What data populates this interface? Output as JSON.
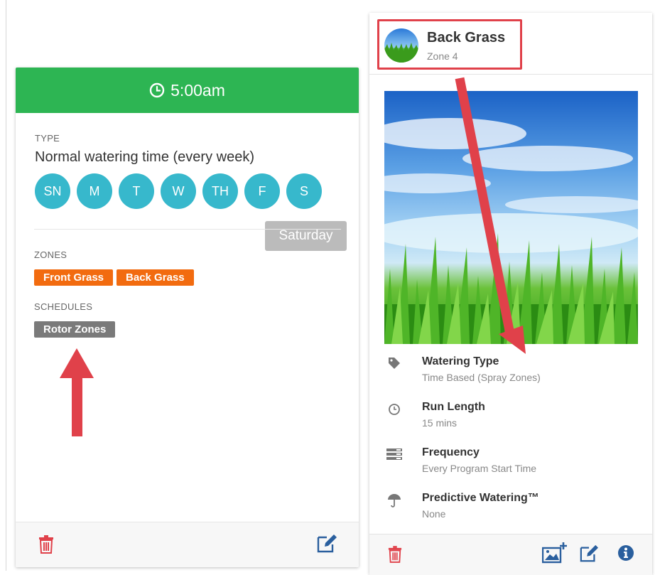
{
  "program": {
    "start_time": "5:00am",
    "type_label": "TYPE",
    "type_value": "Normal watering time (every week)",
    "days": [
      {
        "abbr": "SN"
      },
      {
        "abbr": "M"
      },
      {
        "abbr": "T"
      },
      {
        "abbr": "W"
      },
      {
        "abbr": "TH"
      },
      {
        "abbr": "F"
      },
      {
        "abbr": "S"
      }
    ],
    "day_tooltip": "Saturday",
    "zones_label": "ZONES",
    "zones": [
      "Front Grass",
      "Back Grass"
    ],
    "schedules_label": "SCHEDULES",
    "schedules": [
      "Rotor Zones"
    ]
  },
  "zone": {
    "name": "Back Grass",
    "number": "Zone 4",
    "details": [
      {
        "icon": "tag-icon",
        "title": "Watering Type",
        "value": "Time Based (Spray Zones)"
      },
      {
        "icon": "clock-icon",
        "title": "Run Length",
        "value": "15 mins"
      },
      {
        "icon": "list-icon",
        "title": "Frequency",
        "value": "Every Program Start Time"
      },
      {
        "icon": "umbrella-icon",
        "title": "Predictive Watering™",
        "value": "None"
      }
    ]
  },
  "colors": {
    "header_green": "#2db553",
    "day_teal": "#37b8cc",
    "zone_orange": "#f26b0f",
    "schedule_gray": "#7a7a7a",
    "delete_red": "#e0414a",
    "action_blue": "#2a5f9e",
    "annotation_red": "#e0414a"
  }
}
